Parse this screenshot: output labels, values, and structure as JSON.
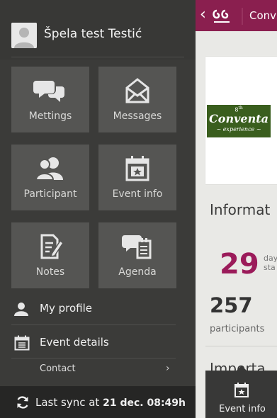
{
  "profile": {
    "name": "Špela test Testić"
  },
  "tiles": [
    {
      "label": "Mettings",
      "icon": "chat-bubbles-icon"
    },
    {
      "label": "Messages",
      "icon": "envelope-icon"
    },
    {
      "label": "Participant",
      "icon": "people-icon"
    },
    {
      "label": "Event info",
      "icon": "calendar-star-icon"
    },
    {
      "label": "Notes",
      "icon": "notes-pencil-icon"
    },
    {
      "label": "Agenda",
      "icon": "agenda-chat-icon"
    }
  ],
  "menu": {
    "my_profile": "My profile",
    "event_details": "Event details",
    "contact": "Contact"
  },
  "sync": {
    "prefix": "Last sync at",
    "datetime": "21 dec. 08:49h"
  },
  "topbar": {
    "title": "Conv"
  },
  "banner": {
    "eighth": "8",
    "eighth_suffix": "th",
    "name": "Conventa",
    "sub": "~ experience ~"
  },
  "section": {
    "title": "Informat"
  },
  "stats": {
    "days_value": "29",
    "days_label_line1": "day",
    "days_label_line2": "sta",
    "participants_value": "257",
    "participants_label": "participants"
  },
  "next_heading": "Importa",
  "tabbar": {
    "label": "Event info"
  },
  "colors": {
    "accent": "#8a1f4f",
    "sidebar": "#3b3b39",
    "tile": "#555553",
    "stat": "#9b1b5a"
  }
}
